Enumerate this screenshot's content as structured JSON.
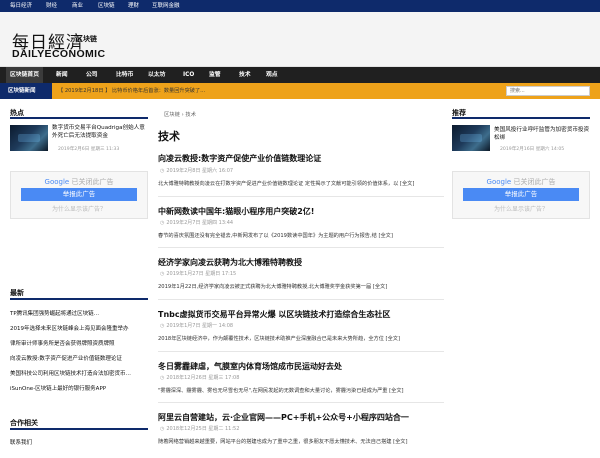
{
  "topbar": {
    "items": [
      "每日经济",
      "财经",
      "商业",
      "区块链",
      "理财",
      "互联网金融"
    ]
  },
  "masthead": {
    "logo_cn": "每日經濟",
    "logo_badge": "区块链",
    "logo_en": "DAILYECONOMIC"
  },
  "nav": {
    "items": [
      "区块链首页",
      "新闻",
      "公司",
      "比特币",
      "以太坊",
      "ICO",
      "监管",
      "技术",
      "观点"
    ],
    "active": 0
  },
  "ticker": {
    "label": "区块链新闻",
    "text": "【 2019年2月18日 】 比特币价格年后首涨：数量回升突破了…",
    "search_placeholder": "搜索..."
  },
  "left": {
    "hot_title": "热点",
    "hot_item": {
      "title": "数字货币交易平台Quadriga创始人意外死亡后无法提取资金",
      "meta": "2019年2月6日 星期三 11:33"
    },
    "ad": {
      "brand": "Google",
      "suffix": "已关闭此广告",
      "button": "举报此广告",
      "why": "为什么显示该广告？"
    },
    "latest_title": "最新",
    "latest_items": [
      "TP腾讯集团强势崛起将通过区块链…",
      "2019年选择未来区块链峰会上海见面会隆重举办",
      "律所审计师事务所是否会获得牌照资质牌照",
      "向凌云教授:数字资产促进产业价值链数理论证",
      "美国科技公司利用区块链技术打造合法加密货币…",
      "iSunOne-区块链上最好的银行服务APP"
    ],
    "partner_title": "合作相关",
    "partner_item": "联系我们"
  },
  "main": {
    "breadcrumb": [
      "区块链",
      "技术"
    ],
    "page_title": "技术",
    "articles": [
      {
        "title": "向凌云教授:数字资产促使产业价值链数理论证",
        "meta": "2019年2月8日 星期六 16:07",
        "summary": "北大博雅特聘教授向凌云在打数字资产促进产业价值链数理论证 定性揭示了文献可能引领的价值体系，以 [全文]"
      },
      {
        "title": "中新网数读中国年:猫眼小程序用户突破2亿!",
        "meta": "2019年2月7日 星期四 13:44",
        "summary": "春节的喜庆氛围还没有完全褪去,中新网发布了以《2019数读中国年》为主题的用户行为报告,结 [全文]"
      },
      {
        "title": "经济学家向凌云获聘为北大博雅特聘教授",
        "meta": "2019年1月27日 星期日 17:15",
        "summary": "2019年1月22日,经济学家向凌云被正式获聘为北大博雅特聘教授,北大博雅奖学金获奖第一届 [全文]"
      },
      {
        "title": "Tnbc虚拟货币交易平台异常火爆 以区块链技术打造综合生态社区",
        "meta": "2019年1月7日 星期一 14:08",
        "summary": "2018年区块链经济中，作为颠覆性技术，区块链技术助推产业深度融合已是未来大势所趋，全方位 [全文]"
      },
      {
        "title": "冬日雾霾肆虐，气膜室内体育场馆成市民运动好去处",
        "meta": "2018年12月26日 星期三 17:08",
        "summary": "\"雾霾深深、霾雾霾、雾也无尽雪也无尽\",在网民发起的无数调查和大量讨论，雾霾污染已经成为严重 [全文]"
      },
      {
        "title": "阿里云自营建站，云·企业官网——PC+手机+公众号+小程序四站合一",
        "meta": "2018年12月25日 星期二 11:52",
        "summary": "随着网络营销越来越重要，网站平台的搭建也成为了重中之重，很多朋友不愿太懂技术、无法自己搭建 [全文]"
      }
    ]
  },
  "right": {
    "rec_title": "推荐",
    "rec_item": {
      "title": "美国风投行业呼吁监管为加密货币投资松绑",
      "meta": "2019年2月16日 星期六 14:05"
    },
    "ad": {
      "brand": "Google",
      "suffix": "已关闭此广告",
      "button": "举报此广告",
      "why": "为什么显示该广告？"
    }
  }
}
